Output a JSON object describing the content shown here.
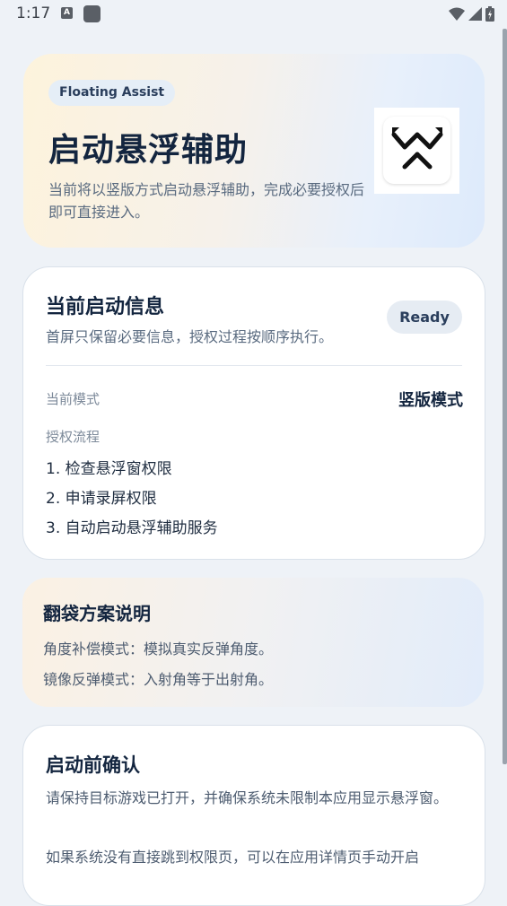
{
  "status_bar": {
    "time": "1:17",
    "a_icon_letter": "A"
  },
  "hero": {
    "badge": "Floating Assist",
    "title": "启动悬浮辅助",
    "description": "当前将以竖版方式启动悬浮辅助，完成必要授权后即可直接进入。"
  },
  "info_card": {
    "title": "当前启动信息",
    "subtitle": "首屏只保留必要信息，授权过程按顺序执行。",
    "status_badge": "Ready",
    "mode_label": "当前模式",
    "mode_value": "竖版模式",
    "flow_label": "授权流程",
    "steps": [
      "1. 检查悬浮窗权限",
      "2. 申请录屏权限",
      "3. 自动启动悬浮辅助服务"
    ]
  },
  "plan_card": {
    "title": "翻袋方案说明",
    "lines": [
      "角度补偿模式：模拟真实反弹角度。",
      "镜像反弹模式：入射角等于出射角。"
    ]
  },
  "confirm_card": {
    "title": "启动前确认",
    "paragraph1": "请保持目标游戏已打开，并确保系统未限制本应用显示悬浮窗。",
    "paragraph2": "如果系统没有直接跳到权限页，可以在应用详情页手动开启"
  }
}
